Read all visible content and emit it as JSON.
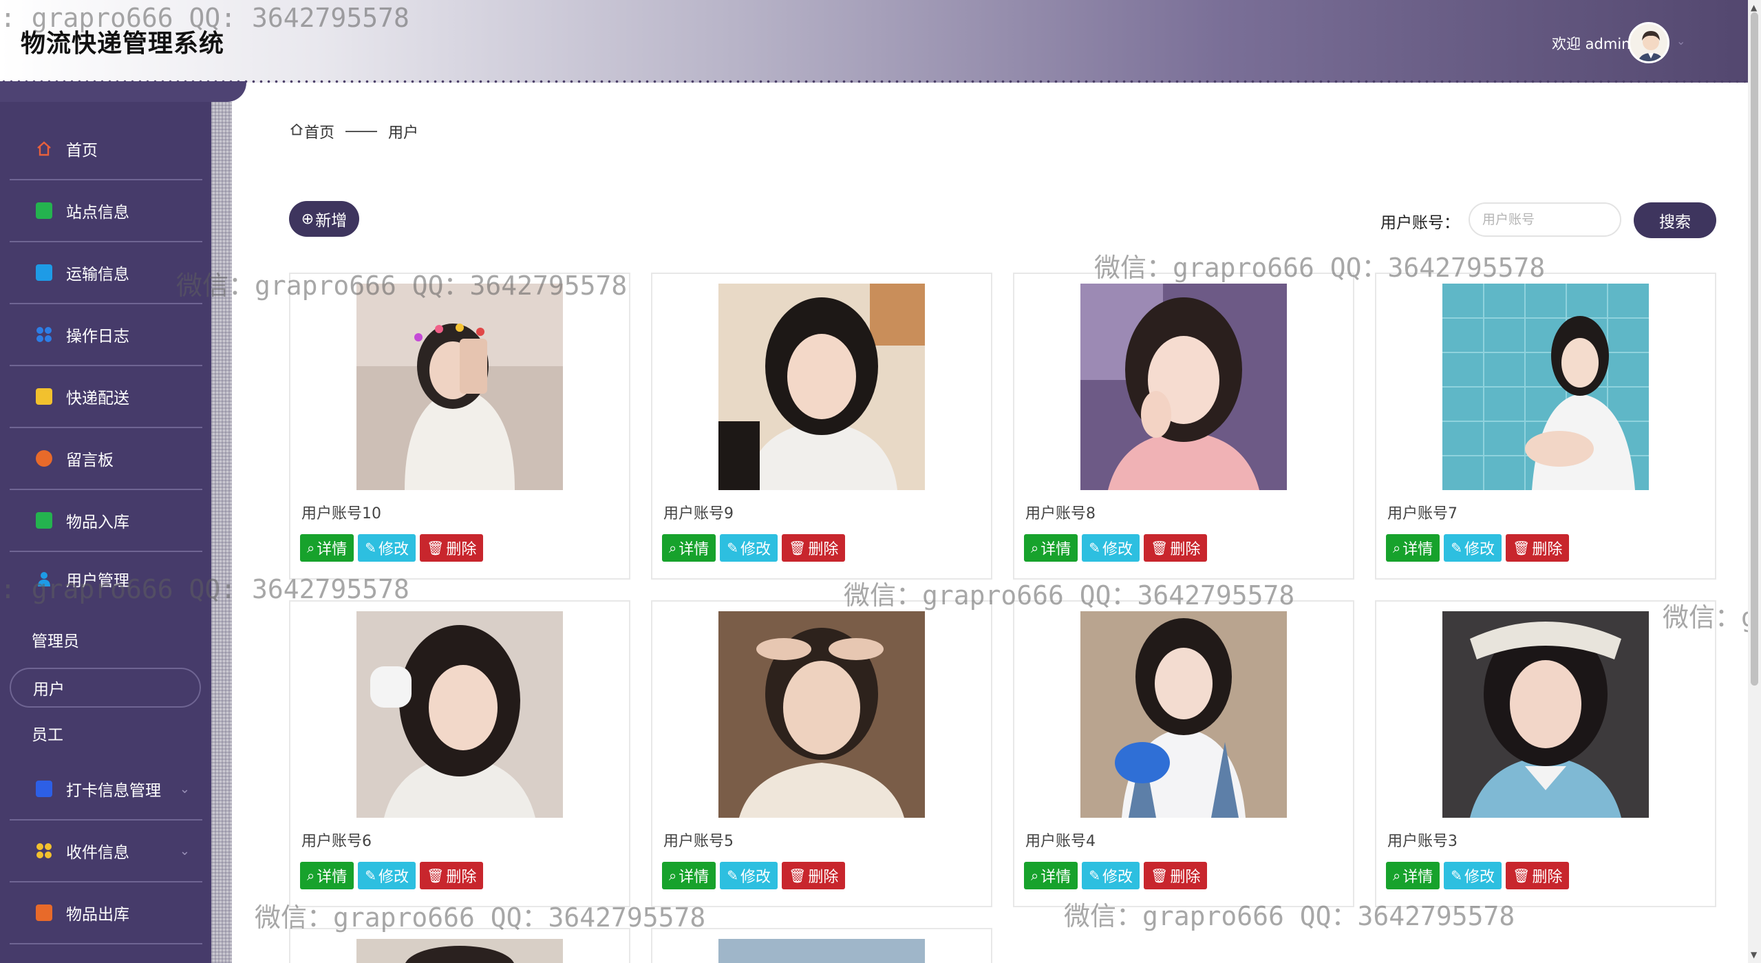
{
  "header": {
    "app_title": "物流快递管理系统",
    "welcome": "欢迎 admin"
  },
  "sidebar": {
    "items": [
      {
        "label": "首页",
        "icon": "home-icon",
        "color": "#e8603c"
      },
      {
        "label": "站点信息",
        "icon": "book-icon",
        "color": "#24b34f"
      },
      {
        "label": "运输信息",
        "icon": "bookmark-icon",
        "color": "#1e9be6"
      },
      {
        "label": "操作日志",
        "icon": "grid-icon",
        "color": "#2d7ee6"
      },
      {
        "label": "快递配送",
        "icon": "note-icon",
        "color": "#f2c12e"
      },
      {
        "label": "留言板",
        "icon": "compass-icon",
        "color": "#e86a2a"
      },
      {
        "label": "物品入库",
        "icon": "mail-icon",
        "color": "#24b34f"
      },
      {
        "label": "用户管理",
        "icon": "user-icon",
        "color": "#1e9be6"
      }
    ],
    "sub_items": [
      {
        "label": "管理员"
      },
      {
        "label": "用户"
      },
      {
        "label": "员工"
      }
    ],
    "items_after": [
      {
        "label": "打卡信息管理",
        "icon": "clock-icon",
        "color": "#2d5fe6"
      },
      {
        "label": "收件信息",
        "icon": "apps-icon",
        "color": "#f2c12e"
      },
      {
        "label": "物品出库",
        "icon": "box-icon",
        "color": "#e86a2a"
      }
    ]
  },
  "breadcrumb": {
    "home": "首页",
    "current": "用户"
  },
  "toolbar": {
    "add_label": "新增",
    "search_label": "用户账号：",
    "search_placeholder": "用户账号",
    "search_button": "搜索"
  },
  "actions": {
    "detail": "详情",
    "edit": "修改",
    "delete": "删除"
  },
  "cards": [
    {
      "name": "用户账号10"
    },
    {
      "name": "用户账号9"
    },
    {
      "name": "用户账号8"
    },
    {
      "name": "用户账号7"
    },
    {
      "name": "用户账号6"
    },
    {
      "name": "用户账号5"
    },
    {
      "name": "用户账号4"
    },
    {
      "name": "用户账号3"
    }
  ],
  "watermark": "微信：grapro666 QQ：3642795578",
  "watermark_partial": ": grapro666 QQ: 3642795578",
  "watermark_edge": "微信：g"
}
